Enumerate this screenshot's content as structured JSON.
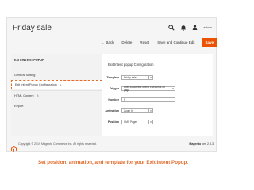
{
  "header": {
    "title": "Friday sale",
    "user_name": "admin"
  },
  "toolbar": {
    "back_label": "Back",
    "delete_label": "Delete",
    "reset_label": "Reset",
    "save_continue_label": "Save and Continue Edit",
    "save_label": "Save"
  },
  "sidebar": {
    "title": "EXIT INTENT POPUP",
    "items": [
      {
        "label": "General Setting"
      },
      {
        "label": "Exit Intent Popup Configuration"
      },
      {
        "label": "HTML Content"
      },
      {
        "label": "Report"
      }
    ]
  },
  "main": {
    "title": "Exit Intent popup Configuration",
    "fields": [
      {
        "label": "Template",
        "value": "Friday sale"
      },
      {
        "label": "Trigger",
        "value": "After customers spend 5 seconds on page"
      },
      {
        "label": "Number",
        "value": "5"
      },
      {
        "label": "Animation",
        "value": "Zoom In"
      },
      {
        "label": "Position",
        "value": "CMS Pages"
      }
    ]
  },
  "footer": {
    "copyright": "Copyright © 2019 Magento Commerce Inc. All rights reserved.",
    "brand": "Magento",
    "version": "ver. 2.3.3"
  },
  "caption": "Set position, animation, and template for your Exit Intent Popup.",
  "colors": {
    "accent": "#eb5202",
    "caption": "#e06d2c"
  }
}
